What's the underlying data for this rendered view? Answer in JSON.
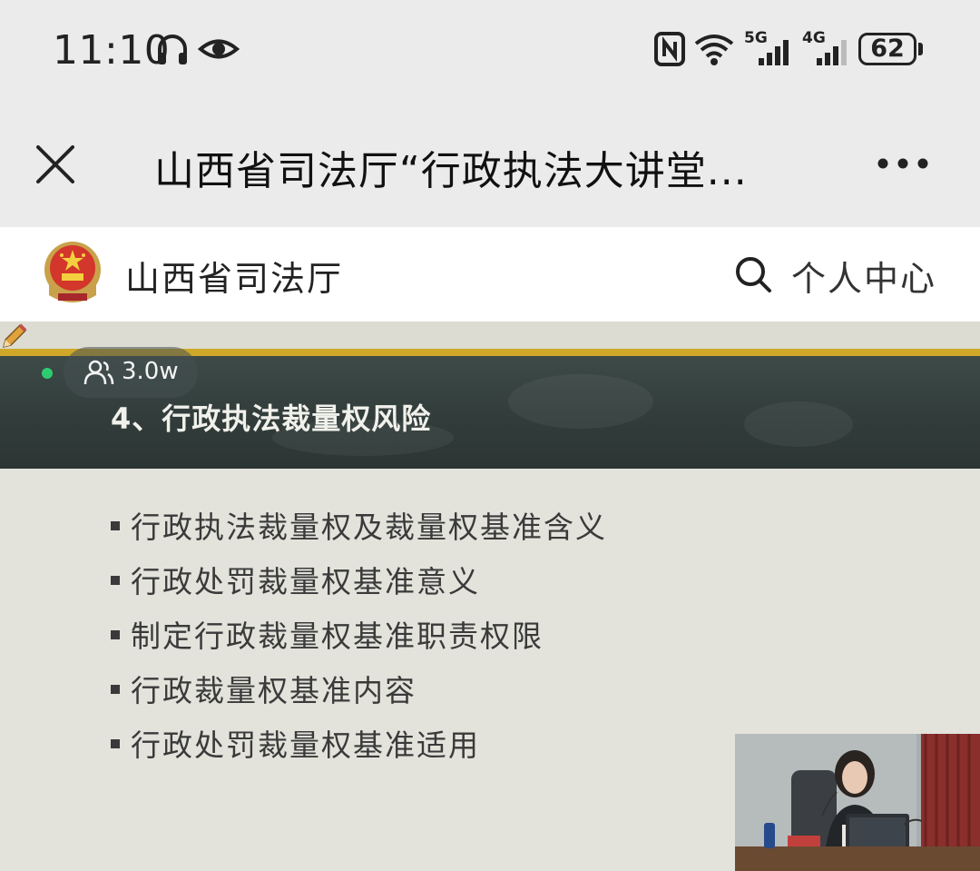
{
  "status_bar": {
    "time": "11:10",
    "battery": "62",
    "signal_5g": "5G",
    "signal_4g": "4G"
  },
  "title_bar": {
    "title": "山西省司法厅“行政执法大讲堂..."
  },
  "site_header": {
    "name": "山西省司法厅",
    "user_center": "个人中心"
  },
  "live": {
    "viewers": "3.0w"
  },
  "slide": {
    "heading": "4、行政执法裁量权风险",
    "bullets": [
      "行政执法裁量权及裁量权基准含义",
      "行政处罚裁量权基准意义",
      "制定行政裁量权基准职责权限",
      "行政裁量权基准内容",
      "行政处罚裁量权基准适用"
    ]
  },
  "colors": {
    "accent_gold": "#cfa82a",
    "chalkboard": "#36413f",
    "live_dot": "#2ecc71"
  }
}
